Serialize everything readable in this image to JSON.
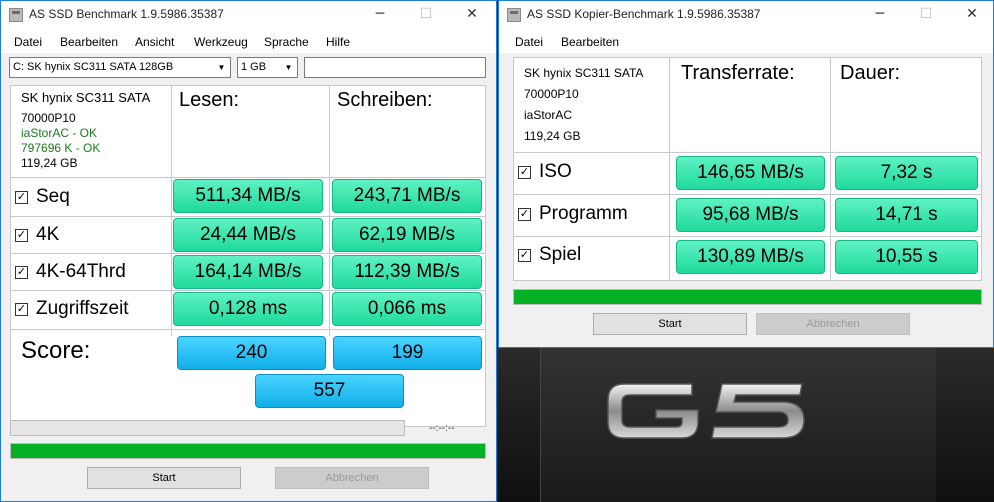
{
  "left_window": {
    "title": "AS SSD Benchmark 1.9.5986.35387",
    "menu": [
      "Datei",
      "Bearbeiten",
      "Ansicht",
      "Werkzeug",
      "Sprache",
      "Hilfe"
    ],
    "drive_select": "C: SK hynix SC311 SATA 128GB",
    "size_select": "1 GB",
    "info": {
      "model": "SK hynix SC311 SATA",
      "firmware": "70000P10",
      "driver_status": "iaStorAC - OK",
      "alignment_status": "797696 K - OK",
      "capacity": "119,24 GB"
    },
    "header_read": "Lesen:",
    "header_write": "Schreiben:",
    "rows": [
      {
        "label": "Seq",
        "read": "511,34 MB/s",
        "write": "243,71 MB/s",
        "checked": true
      },
      {
        "label": "4K",
        "read": "24,44 MB/s",
        "write": "62,19 MB/s",
        "checked": true
      },
      {
        "label": "4K-64Thrd",
        "read": "164,14 MB/s",
        "write": "112,39 MB/s",
        "checked": true
      },
      {
        "label": "Zugriffszeit",
        "read": "0,128 ms",
        "write": "0,066 ms",
        "checked": true
      }
    ],
    "score_label": "Score:",
    "score_read": "240",
    "score_write": "199",
    "score_total": "557",
    "timer": "--:--:--",
    "progress_top": 0,
    "progress_bottom": 1.0,
    "start_label": "Start",
    "abort_label": "Abbrechen"
  },
  "right_window": {
    "title": "AS SSD Kopier-Benchmark 1.9.5986.35387",
    "menu": [
      "Datei",
      "Bearbeiten"
    ],
    "info": {
      "model": "SK hynix SC311 SATA",
      "firmware": "70000P10",
      "driver": "iaStorAC",
      "capacity": "119,24 GB"
    },
    "header_rate": "Transferrate:",
    "header_duration": "Dauer:",
    "rows": [
      {
        "label": "ISO",
        "rate": "146,65 MB/s",
        "duration": "7,32 s",
        "checked": true
      },
      {
        "label": "Programm",
        "rate": "95,68 MB/s",
        "duration": "14,71 s",
        "checked": true
      },
      {
        "label": "Spiel",
        "rate": "130,89 MB/s",
        "duration": "10,55 s",
        "checked": true
      }
    ],
    "progress": 1.0,
    "start_label": "Start",
    "abort_label": "Abbrechen"
  },
  "window_controls": {
    "minimize": "─",
    "maximize": "☐",
    "close": "✕"
  },
  "icons": {
    "checkbox": "checkbox-checked-icon",
    "dropdown": "chevron-down-icon"
  },
  "colors": {
    "value_box": "#1fd99c",
    "score_box": "#11aee9",
    "progress": "#06b025",
    "accent_border": "#1a7fd4"
  }
}
